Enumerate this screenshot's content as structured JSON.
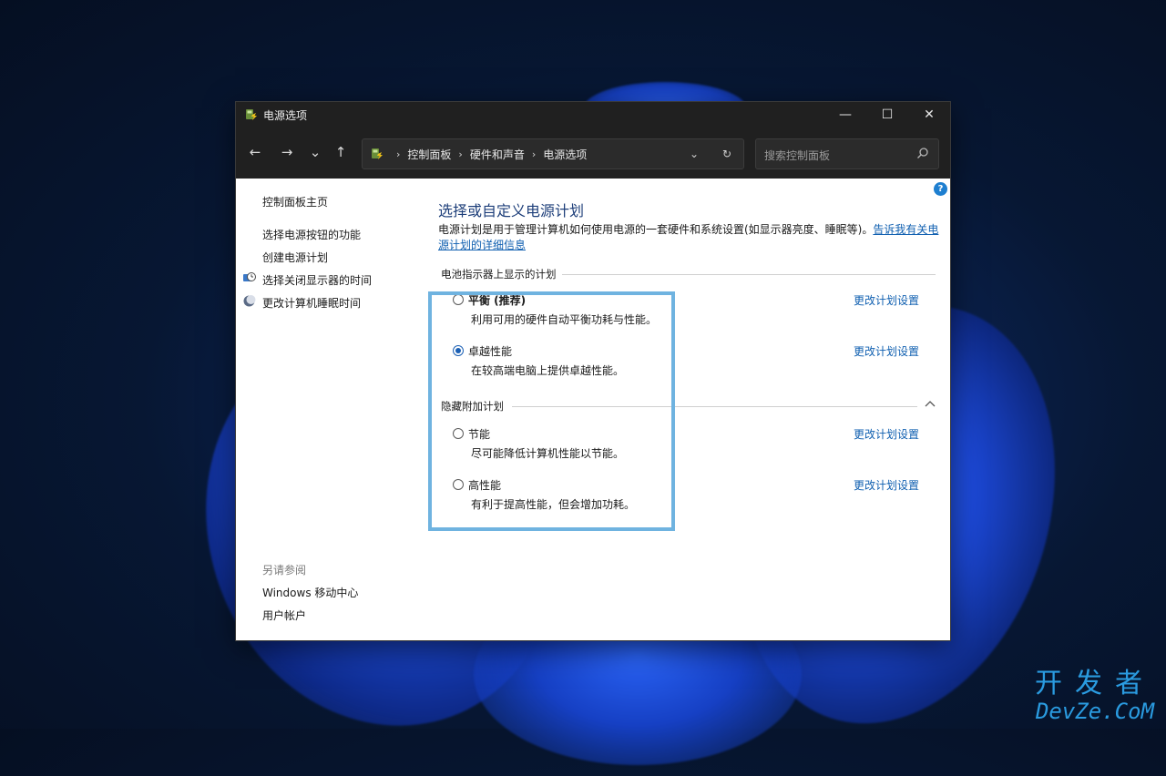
{
  "window": {
    "title": "电源选项",
    "app_icon": "power-options-icon"
  },
  "titlebar_controls": {
    "minimize": "—",
    "maximize": "☐",
    "close": "✕"
  },
  "nav": {
    "back": "←",
    "forward": "→",
    "recent": "⌄",
    "up": "↑"
  },
  "address": {
    "separator": "›",
    "crumbs": [
      "控制面板",
      "硬件和声音",
      "电源选项"
    ],
    "dropdown": "⌄",
    "refresh": "↻"
  },
  "search": {
    "placeholder": "搜索控制面板"
  },
  "help": {
    "label": "?"
  },
  "sidebar": {
    "home": "控制面板主页",
    "items": [
      {
        "label": "选择电源按钮的功能"
      },
      {
        "label": "创建电源计划"
      },
      {
        "label": "选择关闭显示器的时间",
        "icon": "monitor-clock-icon"
      },
      {
        "label": "更改计算机睡眠时间",
        "icon": "moon-icon"
      }
    ],
    "see_also": "另请参阅",
    "see_also_items": [
      {
        "label": "Windows 移动中心"
      },
      {
        "label": "用户帐户"
      }
    ]
  },
  "main": {
    "title": "选择或自定义电源计划",
    "description": "电源计划是用于管理计算机如何使用电源的一套硬件和系统设置(如显示器亮度、睡眠等)。",
    "description_link": "告诉我有关电源计划的详细信息",
    "battery_section": "电池指示器上显示的计划",
    "hidden_section": "隐藏附加计划",
    "change_label": "更改计划设置",
    "plans": [
      {
        "name": "平衡 (推荐)",
        "desc": "利用可用的硬件自动平衡功耗与性能。",
        "selected": false
      },
      {
        "name": "卓越性能",
        "desc": "在较高端电脑上提供卓越性能。",
        "selected": true
      },
      {
        "name": "节能",
        "desc": "尽可能降低计算机性能以节能。",
        "selected": false
      },
      {
        "name": "高性能",
        "desc": "有利于提高性能，但会增加功耗。",
        "selected": false
      }
    ]
  },
  "watermark": {
    "line1": "开发者",
    "line2": "DevZe.CoM"
  },
  "colors": {
    "accent": "#1a5fb4",
    "link": "#0f5fb0",
    "highlight": "#6fb3e0",
    "titlebar": "#202020"
  }
}
